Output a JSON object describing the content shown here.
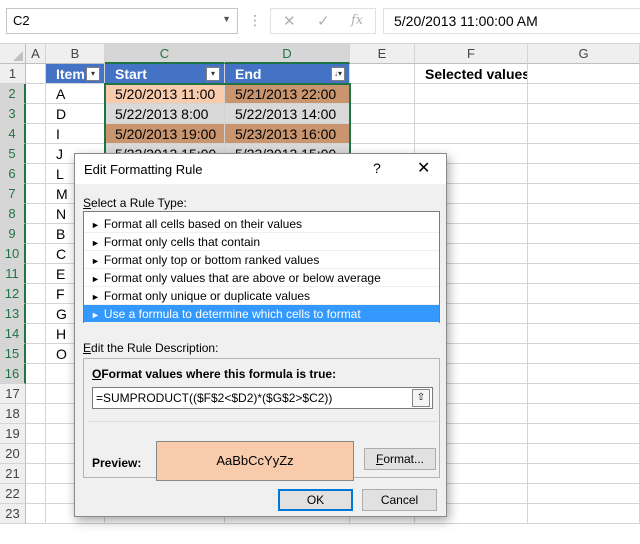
{
  "formula_bar": {
    "name_box": "C2",
    "cancel_icon": "✕",
    "enter_icon": "✓",
    "fx_label": "fx",
    "formula": "5/20/2013  11:00:00 AM"
  },
  "columns": [
    "A",
    "B",
    "C",
    "D",
    "E",
    "F",
    "G"
  ],
  "rows": [
    "1",
    "2",
    "3",
    "4",
    "5",
    "6",
    "7",
    "8",
    "9",
    "10",
    "11",
    "12",
    "13",
    "14",
    "15",
    "16",
    "17",
    "18",
    "19",
    "20",
    "21",
    "22",
    "23"
  ],
  "table": {
    "headers": [
      "Item",
      "Start",
      "End"
    ],
    "items": [
      "A",
      "D",
      "I",
      "J",
      "L",
      "M",
      "N",
      "B",
      "C",
      "E",
      "F",
      "G",
      "H",
      "O"
    ],
    "start": [
      "5/20/2013 11:00",
      "5/22/2013 8:00",
      "5/20/2013 19:00",
      "5/22/2013 15:00"
    ],
    "end": [
      "5/21/2013 22:00",
      "5/22/2013 14:00",
      "5/23/2013 16:00",
      "5/23/2013 15:00"
    ]
  },
  "f1_label": "Selected values",
  "colors": {
    "header_blue": "#4472c4",
    "highlight_orange": "#f8cbad",
    "highlight_brown": "#c9956e",
    "row_gray": "#d9d9d9",
    "excel_green": "#217346",
    "selection_blue": "#3399ff"
  },
  "dialog": {
    "title": "Edit Formatting Rule",
    "help": "?",
    "close": "✕",
    "select_rule_label_u": "S",
    "select_rule_label": "elect a Rule Type:",
    "rules": [
      "Format all cells based on their values",
      "Format only cells that contain",
      "Format only top or bottom ranked values",
      "Format only values that are above or below average",
      "Format only unique or duplicate values",
      "Use a formula to determine which cells to format"
    ],
    "edit_desc_label_u": "E",
    "edit_desc_label": "dit the Rule Description:",
    "formula_caption_u": "O",
    "formula_caption": "Format values where this formula is true:",
    "formula_value": "=SUMPRODUCT(($F$2<$D2)*($G$2>$C2))",
    "preview_label": "Preview:",
    "preview_sample": "AaBbCcYyZz",
    "format_button_u": "F",
    "format_button": "ormat...",
    "ok_button": "OK",
    "cancel_button": "Cancel"
  }
}
